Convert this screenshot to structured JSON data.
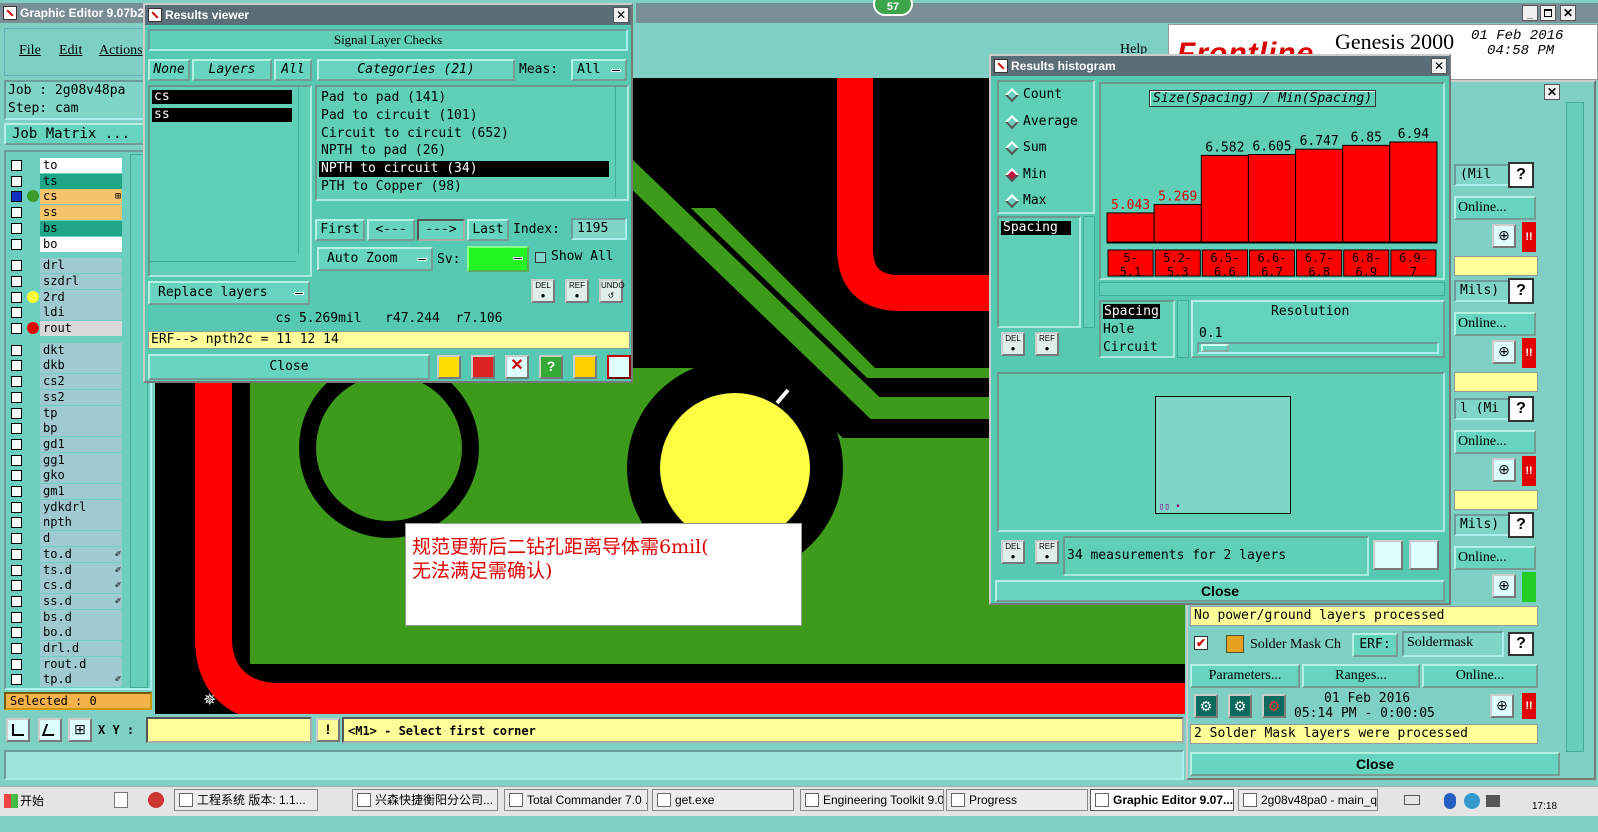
{
  "main_window": {
    "title": "Graphic Editor 9.07b2",
    "menu": [
      "File",
      "Edit",
      "Actions"
    ],
    "job_label": "Job : 2g08v48pa",
    "step_label": "Step: cam",
    "job_matrix": "Job Matrix ...",
    "help": "Help",
    "selected": "Selected : 0",
    "xy_label": "X Y :",
    "xy_value": "",
    "status_msg": "<M1> - Select first corner",
    "brand": "Frontline",
    "product": "Genesis 2000",
    "date": "01 Feb 2016",
    "time": "04:58 PM",
    "badge": "57"
  },
  "layers": [
    {
      "name": "to",
      "color": "#ffffff"
    },
    {
      "name": "ts",
      "color": "#1ea58a"
    },
    {
      "name": "cs",
      "color": "#f5c36a",
      "dot": "#3a9a2a",
      "sel": true,
      "mark": "⊞"
    },
    {
      "name": "ss",
      "color": "#f5c36a"
    },
    {
      "name": "bs",
      "color": "#1ea58a"
    },
    {
      "name": "bo",
      "color": "#ffffff"
    },
    {
      "name": "drl",
      "color": "#9fcad2"
    },
    {
      "name": "szdrl",
      "color": "#9fcad2"
    },
    {
      "name": "2rd",
      "color": "#9fcad2",
      "dot": "#ffff33"
    },
    {
      "name": "ldi",
      "color": "#9fcad2"
    },
    {
      "name": "rout",
      "color": "#d9d9d9",
      "dot": "#e00000"
    },
    {
      "name": "dkt",
      "color": "#9fcad2"
    },
    {
      "name": "dkb",
      "color": "#9fcad2"
    },
    {
      "name": "cs2",
      "color": "#9fcad2"
    },
    {
      "name": "ss2",
      "color": "#9fcad2"
    },
    {
      "name": "tp",
      "color": "#9fcad2"
    },
    {
      "name": "bp",
      "color": "#9fcad2"
    },
    {
      "name": "gd1",
      "color": "#9fcad2"
    },
    {
      "name": "gg1",
      "color": "#9fcad2"
    },
    {
      "name": "gko",
      "color": "#9fcad2"
    },
    {
      "name": "gm1",
      "color": "#9fcad2"
    },
    {
      "name": "ydkdrl",
      "color": "#9fcad2"
    },
    {
      "name": "npth",
      "color": "#9fcad2"
    },
    {
      "name": "d",
      "color": "#9fcad2"
    },
    {
      "name": "to.d",
      "color": "#9fcad2",
      "mark": "✐"
    },
    {
      "name": "ts.d",
      "color": "#9fcad2",
      "mark": "✐"
    },
    {
      "name": "cs.d",
      "color": "#9fcad2",
      "mark": "✐"
    },
    {
      "name": "ss.d",
      "color": "#9fcad2",
      "mark": "✐"
    },
    {
      "name": "bs.d",
      "color": "#9fcad2"
    },
    {
      "name": "bo.d",
      "color": "#9fcad2"
    },
    {
      "name": "drl.d",
      "color": "#9fcad2"
    },
    {
      "name": "rout.d",
      "color": "#9fcad2"
    },
    {
      "name": "tp.d",
      "color": "#9fcad2",
      "mark": "✐"
    }
  ],
  "results_viewer": {
    "title": "Results viewer",
    "header": "Signal Layer Checks",
    "none": "None",
    "layers": "Layers",
    "all": "All",
    "layer_list": [
      "cs",
      "ss"
    ],
    "categories": "Categories (21)",
    "meas_label": "Meas:",
    "meas_value": "All",
    "category_list": [
      "Pad to pad (141)",
      "Pad to circuit (101)",
      "Circuit to circuit (652)",
      "NPTH to pad (26)",
      "NPTH to circuit (34)",
      "PTH to Copper (98)"
    ],
    "selected_category": "NPTH to circuit (34)",
    "first": "First",
    "prev": "<---",
    "next": "--->",
    "last": "Last",
    "index_label": "Index:",
    "index_value": "1195",
    "auto_zoom": "Auto Zoom",
    "sv_label": "Sv:",
    "show_all": "Show All",
    "replace_layers": "Replace layers",
    "measure_info": "cs 5.269mil   r47.244  r7.106",
    "erf_info": "ERF--> npth2c = 11 12 14",
    "close": "Close"
  },
  "histogram": {
    "title": "Results histogram",
    "modes": [
      "Count",
      "Average",
      "Sum",
      "Min",
      "Max"
    ],
    "selected_mode": "Min",
    "chart_title": "Size(Spacing) / Min(Spacing)",
    "list_item": "Spacing",
    "types": [
      "Spacing",
      "Hole",
      "Circuit"
    ],
    "resolution_label": "Resolution",
    "resolution_value": "0.1",
    "measurements": "34 measurements for 2 layers",
    "close": "Close"
  },
  "chart_data": {
    "type": "bar",
    "title": "Size(Spacing) / Min(Spacing)",
    "categories": [
      "5-5.1",
      "5.2-5.3",
      "6.5-6.6",
      "6.6-6.7",
      "6.7-6.8",
      "6.8-6.9",
      "6.9-7"
    ],
    "values": [
      5.043,
      5.269,
      6.582,
      6.605,
      6.747,
      6.85,
      6.94
    ],
    "value_labels": [
      "5.043",
      "5.269",
      "6.582",
      "6.605",
      "6.747",
      "6.85",
      "6.94"
    ],
    "tick_labels_top": [
      "5-",
      "5.2-",
      "6.5-",
      "6.6-",
      "6.7-",
      "6.8-",
      "6.9-"
    ],
    "tick_labels_bottom": [
      "5.1",
      "5.3",
      "6.6",
      "6.7",
      "6.8",
      "6.9",
      "7"
    ],
    "bar_color": "#ff0000"
  },
  "annotation": {
    "line1": "规范更新后二钻孔距离导体需6mil(",
    "line2": "无法满足需确认)"
  },
  "right_panel": {
    "mil_labels": [
      "(Mil",
      "Mils)",
      "l (Mi",
      "Mils)"
    ],
    "online": "Online...",
    "no_power": "No power/ground layers processed",
    "solder_mask": "Solder Mask Ch",
    "erf_label": "ERF:",
    "erf_value": "Soldermask",
    "parameters": "Parameters...",
    "ranges": "Ranges...",
    "online2": "Online...",
    "run_date": "01 Feb 2016",
    "run_time": "05:14 PM - 0:00:05",
    "processed": "2 Solder Mask layers were processed",
    "close": "Close"
  },
  "taskbar": {
    "start": "开始",
    "items": [
      "工程系统  版本: 1.1...",
      "兴森快捷衡阳分公司...",
      "Total Commander 7.0 ...",
      "get.exe",
      "Engineering Toolkit 9.0...",
      "Progress",
      "Graphic Editor 9.07...",
      "2g08v48pa0 - main_qa"
    ],
    "clock": "17:18"
  }
}
